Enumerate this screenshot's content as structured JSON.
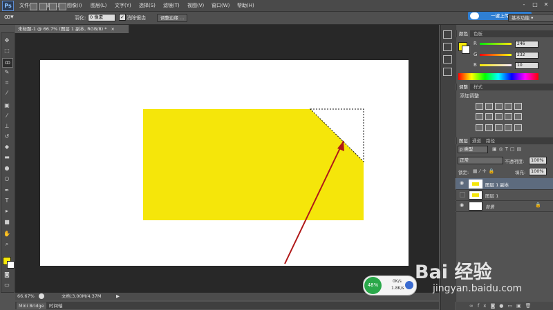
{
  "app": {
    "logo": "Ps"
  },
  "menu": [
    "文件(F)",
    "编辑(E)",
    "图像(I)",
    "图层(L)",
    "文字(Y)",
    "选择(S)",
    "滤镜(T)",
    "视图(V)",
    "窗口(W)",
    "帮助(H)"
  ],
  "window_controls": [
    "-",
    "□",
    "✕"
  ],
  "options": {
    "feather_label": "羽化:",
    "feather_value": "0 像素",
    "antialias_label": "消除锯齿",
    "refine_button": "调整边缘 ...",
    "upload_button": "一键上传",
    "workspace": "基本功能"
  },
  "document": {
    "tab_title": "未标题-1 @ 66.7% (图层 1 副本, RGB/8) *",
    "zoom": "66.67%",
    "doc_info": "文档:3.00M/4.37M"
  },
  "bottom_tabs": [
    "Mini Bridge",
    "时间轴"
  ],
  "color_panel": {
    "tabs": [
      "颜色",
      "色板"
    ],
    "channels": [
      {
        "label": "R",
        "value": "246"
      },
      {
        "label": "G",
        "value": "232"
      },
      {
        "label": "B",
        "value": "10"
      }
    ],
    "fg_color": "#f6e80a"
  },
  "adjust_panel": {
    "tabs": [
      "调整",
      "样式"
    ],
    "title": "添加调整"
  },
  "layers_panel": {
    "tabs": [
      "图层",
      "通道",
      "路径"
    ],
    "filter": "ρ 类型",
    "blend_mode": "正常",
    "opacity_label": "不透明度:",
    "opacity_value": "100%",
    "lock_label": "锁定:",
    "fill_label": "填充:",
    "fill_value": "100%",
    "layers": [
      {
        "name": "图层 1 副本",
        "selected": true,
        "visible": true
      },
      {
        "name": "图层 1",
        "selected": false,
        "visible": false
      },
      {
        "name": "背景",
        "selected": false,
        "visible": true,
        "locked": true
      }
    ]
  },
  "net_widget": {
    "percent": "48%",
    "up": "0K/s",
    "down": "1.8K/s"
  },
  "watermark": {
    "brand": "Bai  经验",
    "url": "jingyan.baidu.com"
  },
  "colors": {
    "yellow": "#f5e60a",
    "arrow": "#b01818"
  }
}
